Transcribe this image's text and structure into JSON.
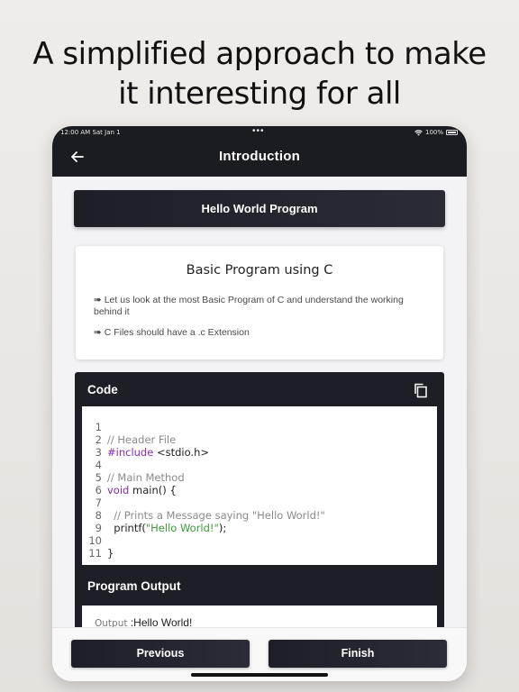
{
  "headline": [
    "A simplified approach to make",
    "it interesting for all"
  ],
  "status_bar": {
    "time": "12:00 AM  Sat Jan 1",
    "dots": "•••",
    "battery": "100%"
  },
  "nav": {
    "title": "Introduction",
    "back_icon": "arrow-left-icon"
  },
  "lesson_button": "Hello World Program",
  "info_card": {
    "title": "Basic Program using C",
    "bullets": [
      "➠ Let us look at the most Basic Program of C and understand the working behind it",
      "➠  C Files should have a .c Extension"
    ]
  },
  "code_section": {
    "heading": "Code",
    "copy_icon": "copy-icon",
    "line_numbers": [
      "1",
      "2",
      "3",
      "4",
      "5",
      "6",
      "7",
      "8",
      "9",
      "10",
      "11"
    ],
    "lines": {
      "l2": "// Header File",
      "l3_kw": "#include",
      "l3_rest": " <stdio.h>",
      "l5": "// Main Method",
      "l6_kw": "void",
      "l6_rest": " main() {",
      "l8": "  // Prints a Message saying \"Hello World!\"",
      "l9_a": "  printf(",
      "l9_str": "\"Hello World!\"",
      "l9_b": ");",
      "l11": "}"
    }
  },
  "output_section": {
    "heading": "Program Output",
    "label": "Output",
    "value": " :Hello World!"
  },
  "footer": {
    "previous": "Previous",
    "finish": "Finish"
  },
  "colors": {
    "dark": "#1e1e27",
    "keyword": "#8b2ab3",
    "string": "#3d9a3d",
    "comment": "#8a8a8a"
  }
}
